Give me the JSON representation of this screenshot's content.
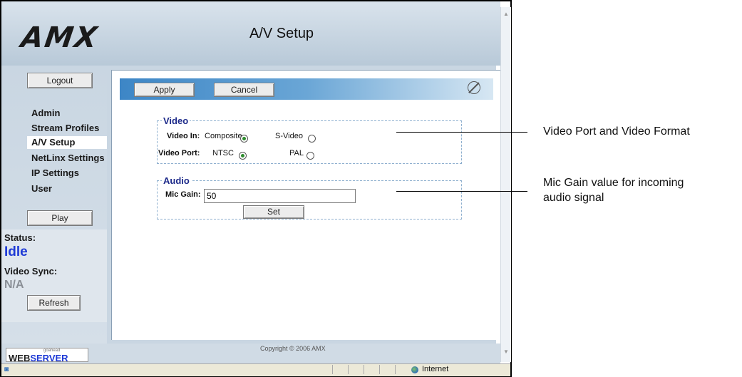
{
  "header": {
    "logo": "AMX",
    "title": "A/V Setup"
  },
  "sidebar": {
    "logout_label": "Logout",
    "items": [
      {
        "label": "Admin",
        "active": false
      },
      {
        "label": "Stream Profiles",
        "active": false
      },
      {
        "label": "A/V Setup",
        "active": true
      },
      {
        "label": "NetLinx Settings",
        "active": false
      },
      {
        "label": "IP Settings",
        "active": false
      },
      {
        "label": "User",
        "active": false
      }
    ],
    "play_label": "Play",
    "status_label": "Status:",
    "status_value": "Idle",
    "video_sync_label": "Video Sync:",
    "video_sync_value": "N/A",
    "refresh_label": "Refresh"
  },
  "toolbar": {
    "apply_label": "Apply",
    "cancel_label": "Cancel"
  },
  "video": {
    "legend": "Video",
    "video_in_label": "Video In:",
    "video_in_options": [
      {
        "label": "Composite",
        "selected": true
      },
      {
        "label": "S-Video",
        "selected": false
      }
    ],
    "video_port_label": "Video Port:",
    "video_port_options": [
      {
        "label": "NTSC",
        "selected": true
      },
      {
        "label": "PAL",
        "selected": false
      }
    ]
  },
  "audio": {
    "legend": "Audio",
    "mic_gain_label": "Mic Gain:",
    "mic_gain_value": "50",
    "set_label": "Set"
  },
  "footer": {
    "copyright": "Copyright © 2006 AMX",
    "webserver_brand_prefix": "WEB",
    "webserver_brand_suffix": "SERVER",
    "webserver_maker": "goahead"
  },
  "statusbar": {
    "zone": "Internet"
  },
  "annotations": {
    "video_note": "Video Port and Video Format",
    "audio_note_line1": "Mic Gain value for incoming",
    "audio_note_line2": "audio signal"
  },
  "colors": {
    "status_idle": "#1e3ad6",
    "status_na": "#8a8f96",
    "legend": "#1d2a8a",
    "radio_selected": "#2e8b2e"
  }
}
